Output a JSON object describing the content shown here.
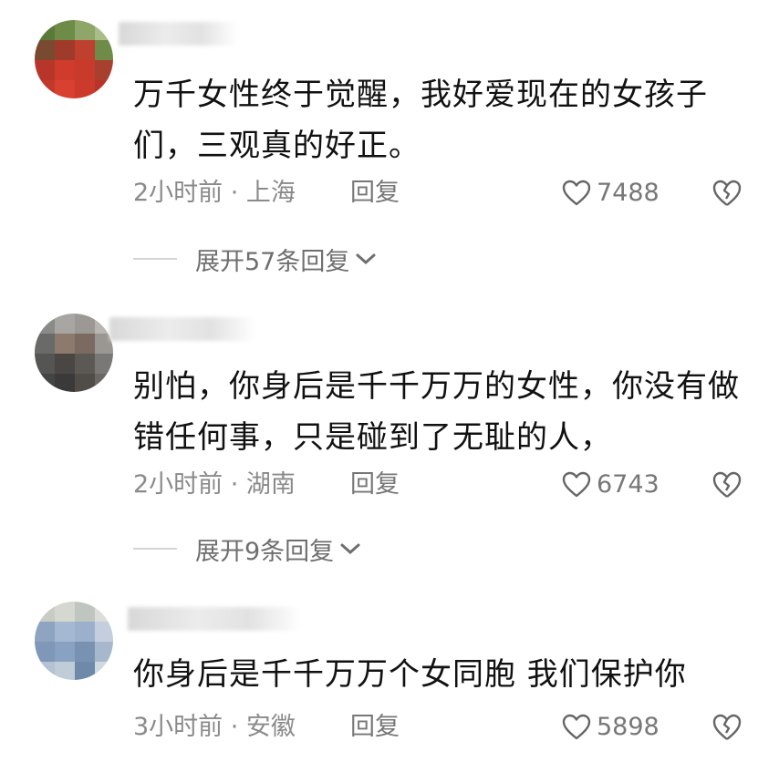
{
  "comments": [
    {
      "text": "万千女性终于觉醒，我好爱现在的女孩子们，三观真的好正。",
      "time_location": "2小时前 · 上海",
      "reply_label": "回复",
      "likes": "7488",
      "expand_label": "展开57条回复"
    },
    {
      "text": "别怕，你身后是千千万万的女性，你没有做错任何事，只是碰到了无耻的人，",
      "time_location": "2小时前 · 湖南",
      "reply_label": "回复",
      "likes": "6743",
      "expand_label": "展开9条回复"
    },
    {
      "text": "你身后是千千万万个女同胞 我们保护你",
      "time_location": "3小时前 · 安徽",
      "reply_label": "回复",
      "likes": "5898"
    }
  ],
  "icons": {
    "like": "heart-outline-icon",
    "dislike": "broken-heart-icon",
    "expand": "chevron-down-icon"
  },
  "colors": {
    "text": "#111111",
    "meta": "#8a8a8a",
    "background": "#ffffff"
  }
}
